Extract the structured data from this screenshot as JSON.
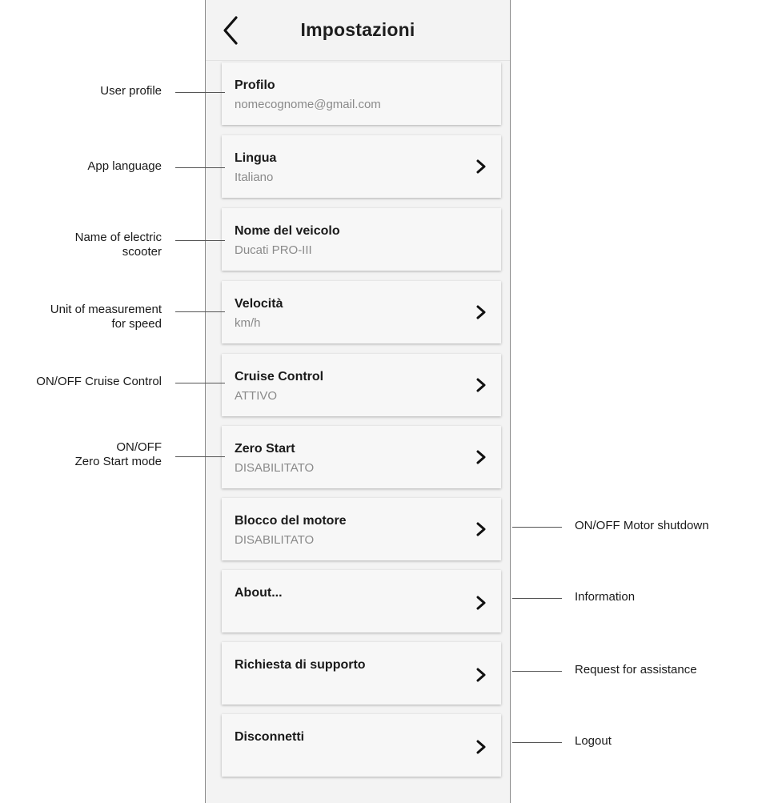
{
  "header": {
    "title": "Impostazioni",
    "back_icon": "chevron-left-icon"
  },
  "settings": [
    {
      "label": "Profilo",
      "value": "nomecognome@gmail.com",
      "has_chevron": false
    },
    {
      "label": "Lingua",
      "value": "Italiano",
      "has_chevron": true
    },
    {
      "label": "Nome del veicolo",
      "value": "Ducati PRO-III",
      "has_chevron": false
    },
    {
      "label": "Velocità",
      "value": "km/h",
      "has_chevron": true
    },
    {
      "label": "Cruise Control",
      "value": "ATTIVO",
      "has_chevron": true
    },
    {
      "label": "Zero Start",
      "value": "DISABILITATO",
      "has_chevron": true
    },
    {
      "label": "Blocco del motore",
      "value": "DISABILITATO",
      "has_chevron": true
    },
    {
      "label": "About...",
      "value": "",
      "has_chevron": true
    },
    {
      "label": "Richiesta di supporto",
      "value": "",
      "has_chevron": true
    },
    {
      "label": "Disconnetti",
      "value": "",
      "has_chevron": true
    }
  ],
  "annotations": {
    "left": [
      {
        "text": "User profile"
      },
      {
        "text": "App language"
      },
      {
        "text": "Name of electric\nscooter"
      },
      {
        "text": "Unit of measurement\nfor speed"
      },
      {
        "text": "ON/OFF Cruise Control"
      },
      {
        "text": "ON/OFF\nZero Start mode"
      }
    ],
    "right": [
      {
        "text": "ON/OFF Motor shutdown"
      },
      {
        "text": "Information"
      },
      {
        "text": "Request for assistance"
      },
      {
        "text": "Logout"
      }
    ]
  },
  "colors": {
    "screen_bg": "#f3f3f3",
    "card_bg": "#f7f7f7",
    "label": "#1a1a1a",
    "value": "#8a8a8a"
  }
}
